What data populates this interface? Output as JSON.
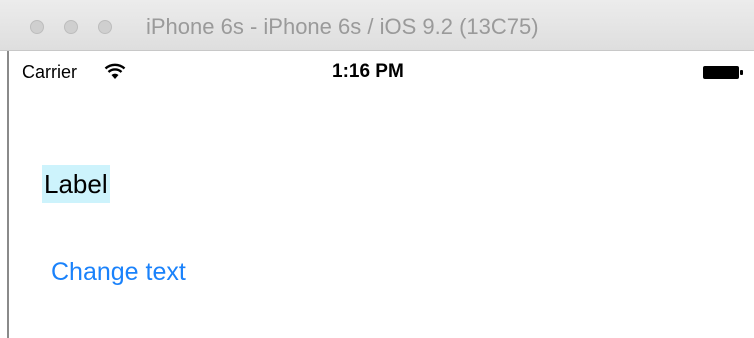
{
  "window": {
    "title": "iPhone 6s - iPhone 6s / iOS 9.2 (13C75)"
  },
  "status_bar": {
    "carrier": "Carrier",
    "time": "1:16 PM",
    "wifi_icon": "wifi-icon",
    "battery_icon": "battery-icon"
  },
  "content": {
    "label_text": "Label",
    "button_label": "Change text"
  },
  "colors": {
    "label_background": "#cdf3fc",
    "button_tint": "#1a82fb"
  }
}
